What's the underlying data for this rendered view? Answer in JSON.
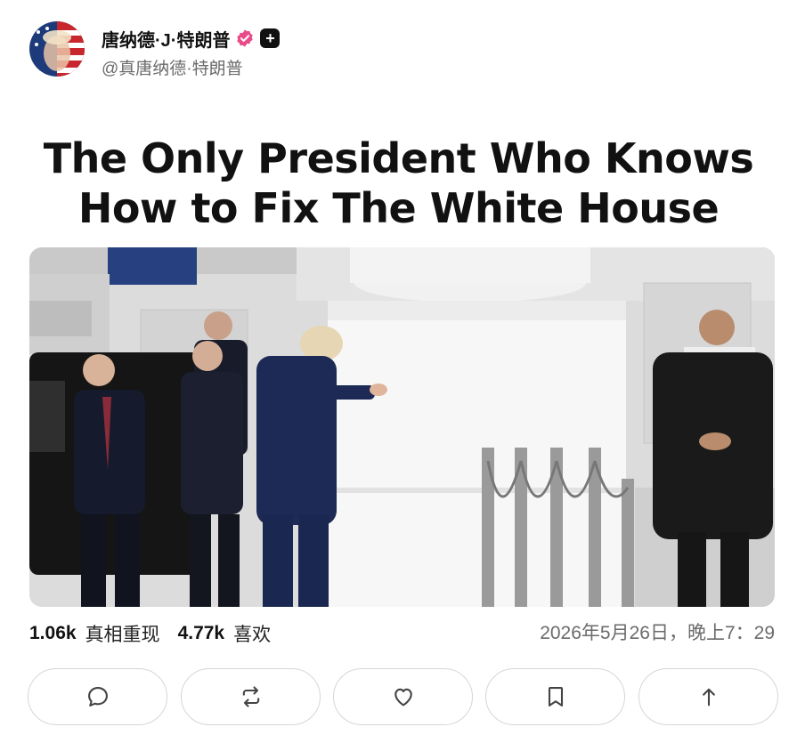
{
  "profile": {
    "display_name": "唐纳德·J·特朗普",
    "handle": "@真唐纳德·特朗普",
    "avatar_icon": "avatar-flag-face",
    "verified_icon": "verified-badge-icon",
    "plus_icon": "plus-badge-icon"
  },
  "post": {
    "headline_line1": "The Only President Who Knows",
    "headline_line2": "How to Fix The White House",
    "image_icon": "photo-man-touching-white-column"
  },
  "stats": {
    "reposts_count": "1.06k",
    "reposts_label": "真相重现",
    "likes_count": "4.77k",
    "likes_label": "喜欢",
    "timestamp": "2026年5月26日，晚上7：29"
  },
  "actions": [
    {
      "icon": "reply-icon"
    },
    {
      "icon": "repost-icon"
    },
    {
      "icon": "like-icon"
    },
    {
      "icon": "bookmark-icon"
    },
    {
      "icon": "share-icon"
    }
  ],
  "colors": {
    "verified": "#e94b8a",
    "text": "#111111",
    "muted": "#6b6b6b",
    "border": "#d6d6d6"
  }
}
